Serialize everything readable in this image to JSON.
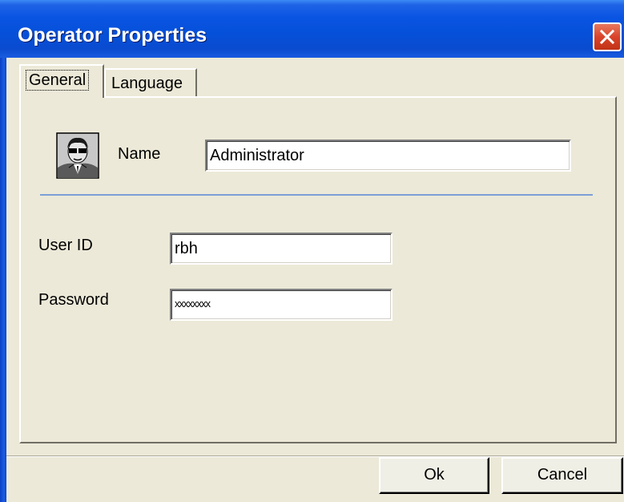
{
  "window": {
    "title": "Operator Properties",
    "close_icon": "close-icon"
  },
  "tabs": [
    {
      "label": "General",
      "selected": true
    },
    {
      "label": "Language",
      "selected": false
    }
  ],
  "general": {
    "avatar_icon": "operator-avatar-icon",
    "name_label": "Name",
    "name_value": "Administrator",
    "user_id_label": "User ID",
    "user_id_value": "rbh",
    "password_label": "Password",
    "password_value": "xxxxxxxx"
  },
  "buttons": {
    "ok": "Ok",
    "cancel": "Cancel"
  },
  "colors": {
    "titlebar": "#0a54e3",
    "close": "#d9442a",
    "separator": "#7b9fd6",
    "face": "#ece9d8"
  }
}
